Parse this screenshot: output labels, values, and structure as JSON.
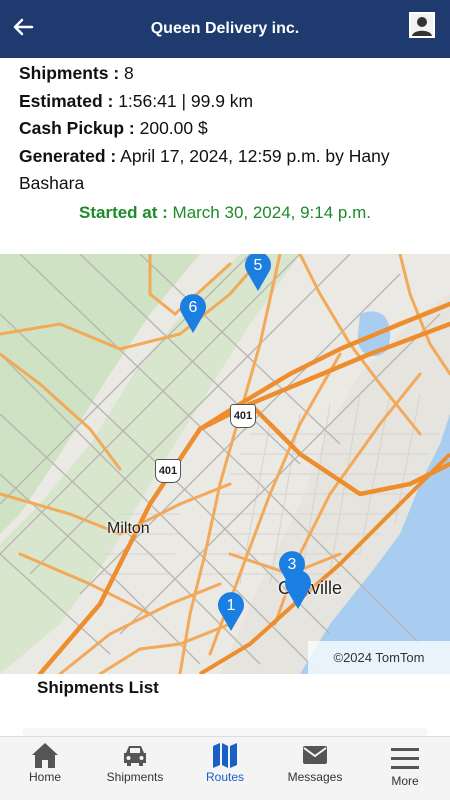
{
  "header": {
    "title": "Queen Delivery inc.",
    "back_icon": "arrow-left-icon",
    "profile_icon": "user-avatar-icon",
    "bg_color": "#1e3a6e"
  },
  "info": {
    "shipments_label": "Shipments :",
    "shipments_value": "8",
    "estimated_label": "Estimated :",
    "estimated_value": "1:56:41 | 99.9 km",
    "cash_label": "Cash Pickup :",
    "cash_value": "200.00 $",
    "generated_label": "Generated :",
    "generated_value": "April 17, 2024, 12:59 p.m. by Hany",
    "generated_value_line2": "Bashara",
    "started_label": "Started at :",
    "started_value": "March 30, 2024, 9:14 p.m.",
    "started_color": "#1d8a2b"
  },
  "map": {
    "labels": {
      "milton": "Milton",
      "oakville": "Oakville",
      "highway_upper": "401",
      "highway_lower": "401"
    },
    "pins": [
      "5",
      "6",
      "3",
      "1"
    ],
    "pin_color": "#1a7fe0",
    "copyright": "©2024 TomTom"
  },
  "list": {
    "title": "Shipments List"
  },
  "nav": {
    "items": [
      {
        "label": "Home",
        "icon": "home-icon"
      },
      {
        "label": "Shipments",
        "icon": "car-icon"
      },
      {
        "label": "Routes",
        "icon": "map-icon"
      },
      {
        "label": "Messages",
        "icon": "envelope-icon"
      },
      {
        "label": "More",
        "icon": "menu-icon"
      }
    ],
    "active": "Routes",
    "active_color": "#1a5fc7"
  }
}
